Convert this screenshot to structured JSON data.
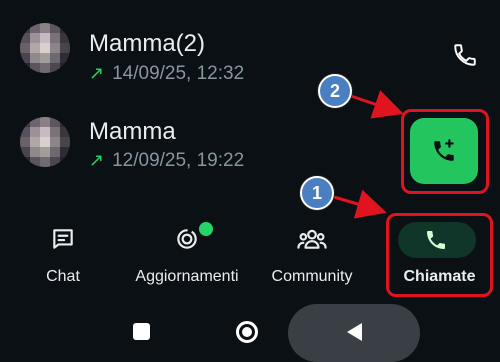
{
  "calls": [
    {
      "name": "Mamma",
      "count": "(2)",
      "direction": "outgoing",
      "timestamp": "14/09/25, 12:32",
      "call_icon": "phone-icon"
    },
    {
      "name": "Mamma",
      "count": "",
      "direction": "outgoing",
      "timestamp": "12/09/25, 19:22"
    }
  ],
  "fab": {
    "icon": "add-call-icon",
    "color": "#22c55e"
  },
  "annotations": [
    {
      "number": "1",
      "target": "Chiamate tab"
    },
    {
      "number": "2",
      "target": "new call button"
    }
  ],
  "bottom_nav": {
    "items": [
      {
        "label": "Chat",
        "icon": "chat-icon",
        "active": false
      },
      {
        "label": "Aggiornamenti",
        "icon": "status-icon",
        "active": false,
        "has_dot": true
      },
      {
        "label": "Community",
        "icon": "community-icon",
        "active": false
      },
      {
        "label": "Chiamate",
        "icon": "phone-icon",
        "active": true
      }
    ]
  },
  "system_nav": {
    "items": [
      "recents-square-icon",
      "home-circle-icon",
      "back-triangle-icon"
    ]
  },
  "colors": {
    "accent": "#25d366",
    "highlight": "#e0141e",
    "badge": "#4a7fc1",
    "background": "#0b1014"
  }
}
